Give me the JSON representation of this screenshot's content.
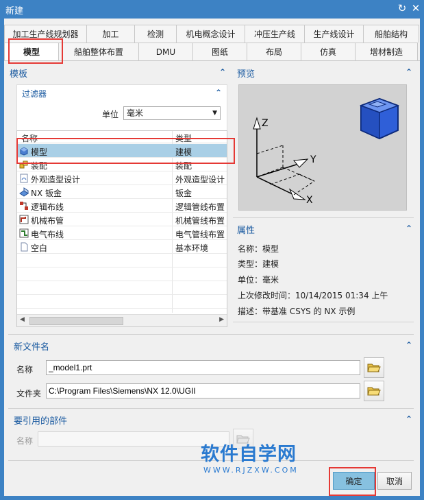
{
  "window": {
    "title": "新建"
  },
  "tabs_row1": [
    "加工生产线规划器",
    "加工",
    "检测",
    "机电概念设计",
    "冲压生产线",
    "生产线设计",
    "船舶结构"
  ],
  "tabs_row2": [
    "模型",
    "船舶整体布置",
    "DMU",
    "图纸",
    "布局",
    "仿真",
    "增材制造"
  ],
  "active_tab": "模型",
  "templates": {
    "title": "模板",
    "filter": {
      "title": "过滤器",
      "unit_label": "单位",
      "unit_value": "毫米"
    },
    "columns": [
      "名称",
      "类型"
    ],
    "rows": [
      {
        "name": "模型",
        "type": "建模",
        "icon": "model-icon"
      },
      {
        "name": "装配",
        "type": "装配",
        "icon": "assembly-icon"
      },
      {
        "name": "外观造型设计",
        "type": "外观造型设计",
        "icon": "shape-design-icon"
      },
      {
        "name": "NX 钣金",
        "type": "钣金",
        "icon": "sheet-metal-icon"
      },
      {
        "name": "逻辑布线",
        "type": "逻辑管线布置",
        "icon": "logic-routing-icon"
      },
      {
        "name": "机械布管",
        "type": "机械管线布置",
        "icon": "mech-piping-icon"
      },
      {
        "name": "电气布线",
        "type": "电气管线布置",
        "icon": "electrical-routing-icon"
      },
      {
        "name": "空白",
        "type": "基本环境",
        "icon": "blank-icon"
      }
    ],
    "selected_index": 0
  },
  "preview": {
    "title": "预览",
    "axis_x": "X",
    "axis_y": "Y",
    "axis_z": "Z"
  },
  "properties": {
    "title": "属性",
    "lines": [
      {
        "label": "名称：",
        "value": "模型"
      },
      {
        "label": "类型：",
        "value": "建模"
      },
      {
        "label": "单位：",
        "value": "毫米"
      },
      {
        "label": "上次修改时间：",
        "value": "10/14/2015 01:34 上午"
      },
      {
        "label": "描述：",
        "value": "带基准 CSYS 的 NX 示例"
      }
    ]
  },
  "new_file": {
    "title": "新文件名",
    "name_label": "名称",
    "name_value": "_model1.prt",
    "folder_label": "文件夹",
    "folder_value": "C:\\Program Files\\Siemens\\NX 12.0\\UGII"
  },
  "ref_parts": {
    "title": "要引用的部件",
    "name_label": "名称",
    "name_value": ""
  },
  "buttons": {
    "ok": "确定",
    "cancel": "取消"
  },
  "watermark": {
    "main": "软件自学网",
    "sub": "WWW.RJZXW.COM"
  },
  "colors": {
    "title_bar": "#3d82c4",
    "selected_row": "#a9cfe6",
    "section_title": "#1a5aa0",
    "highlight": "#e53935"
  }
}
